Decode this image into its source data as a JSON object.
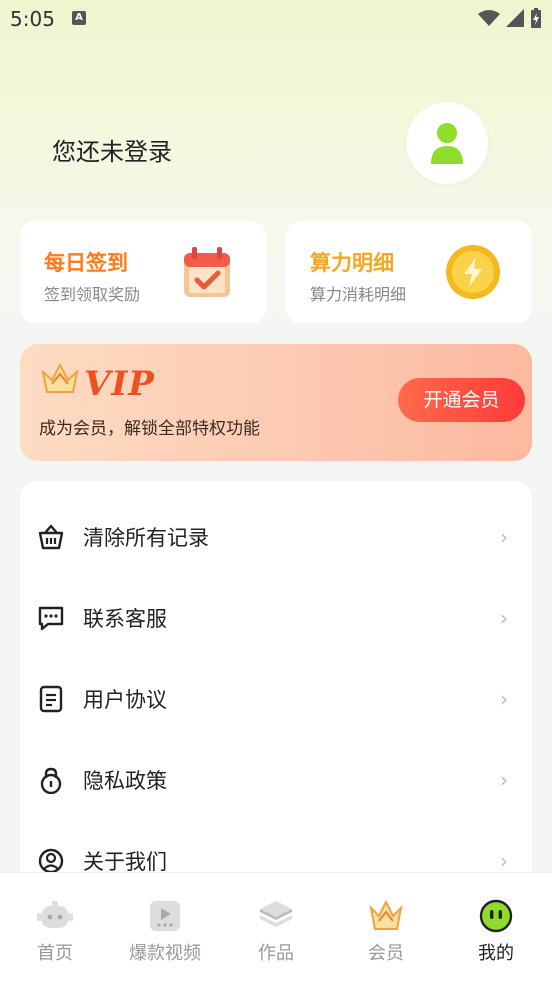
{
  "status_bar": {
    "time": "5:05",
    "notif_glyph": "A"
  },
  "profile": {
    "login_text": "您还未登录"
  },
  "cards": [
    {
      "title": "每日签到",
      "subtitle": "签到领取奖励",
      "title_color": "#ff7a1a",
      "icon": "calendar-check-icon"
    },
    {
      "title": "算力明细",
      "subtitle": "算力消耗明细",
      "title_color": "#f5a623",
      "icon": "lightning-coin-icon"
    }
  ],
  "vip": {
    "badge": "VIP",
    "description": "成为会员，解锁全部特权功能",
    "button_label": "开通会员"
  },
  "menu": {
    "items": [
      {
        "label": "清除所有记录",
        "icon": "basket-icon"
      },
      {
        "label": "联系客服",
        "icon": "chat-bubble-icon"
      },
      {
        "label": "用户协议",
        "icon": "document-icon"
      },
      {
        "label": "隐私政策",
        "icon": "lock-icon"
      },
      {
        "label": "关于我们",
        "icon": "user-circle-icon"
      }
    ],
    "arrow": "›"
  },
  "tabbar": {
    "tabs": [
      {
        "label": "首页",
        "icon": "robot-icon"
      },
      {
        "label": "爆款视频",
        "icon": "video-icon"
      },
      {
        "label": "作品",
        "icon": "layers-icon"
      },
      {
        "label": "会员",
        "icon": "crown-icon"
      },
      {
        "label": "我的",
        "icon": "smiley-face-icon",
        "active": true
      }
    ]
  },
  "colors": {
    "accent_green": "#8fdc2a",
    "vip_red": "#ff4a3a"
  }
}
